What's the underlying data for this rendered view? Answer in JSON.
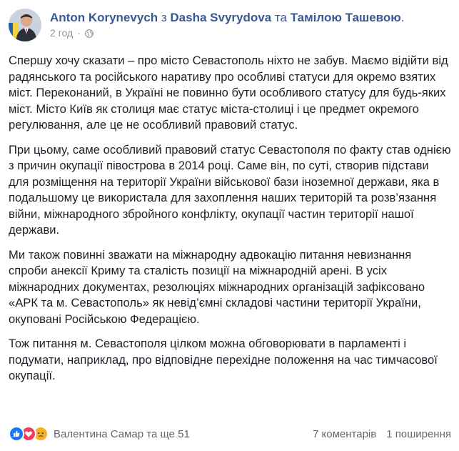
{
  "header": {
    "author": "Anton Korynevych",
    "with_word": "з",
    "tagged_1": "Dasha Svyrydova",
    "and_word": "та",
    "tagged_2": "Тамілою Ташевою",
    "period": ".",
    "time": "2 год",
    "dot": "·",
    "privacy_icon": "globe-icon"
  },
  "post": {
    "paragraphs": [
      "Спершу хочу сказати – про місто Севастополь ніхто не забув. Маємо відійти від радянського та російського наративу про особливі статуси для окремо взятих міст. Переконаний, в Україні не повинно бути особливого статусу для будь-яких міст. Місто Київ як столиця має статус міста-столиці і це предмет окремого регулювання, але це не особливий правовий статус.",
      "При цьому, саме особливий правовий статус Севастополя по факту став однією з причин окупації півострова в 2014 році. Саме він, по суті, створив підстави для розміщення на території України військової бази іноземної держави, яка в подальшому це використала для захоплення наших територій та розв’язання війни, міжнародного збройного конфлікту, окупації частин території нашої держави.",
      "Ми також повинні зважати на міжнародну адвокацію питання невизнання спроби анексії Криму та сталість позиції на міжнародній арені. В усіх міжнародних документах, резолюціях міжнародних організацій зафіксовано «АРК та м. Севастополь» як невід’ємні складові частини території України, окуповані Російською Федерацією.",
      "Тож питання м. Севастополя цілком можна обговорювати в парламенті і подумати, наприклад, про відповідне перехідне положення на час тимчасової окупації."
    ]
  },
  "footer": {
    "reactions": [
      "like-icon",
      "love-icon",
      "sad-icon"
    ],
    "reactors": "Валентина Самар та ще 51",
    "comments": "7 коментарів",
    "shares": "1 поширення"
  },
  "colors": {
    "link": "#385898",
    "text": "#1d2129",
    "meta": "#90949c",
    "like": "#1877f2",
    "love": "#f33e58",
    "sad": "#f7b125"
  }
}
